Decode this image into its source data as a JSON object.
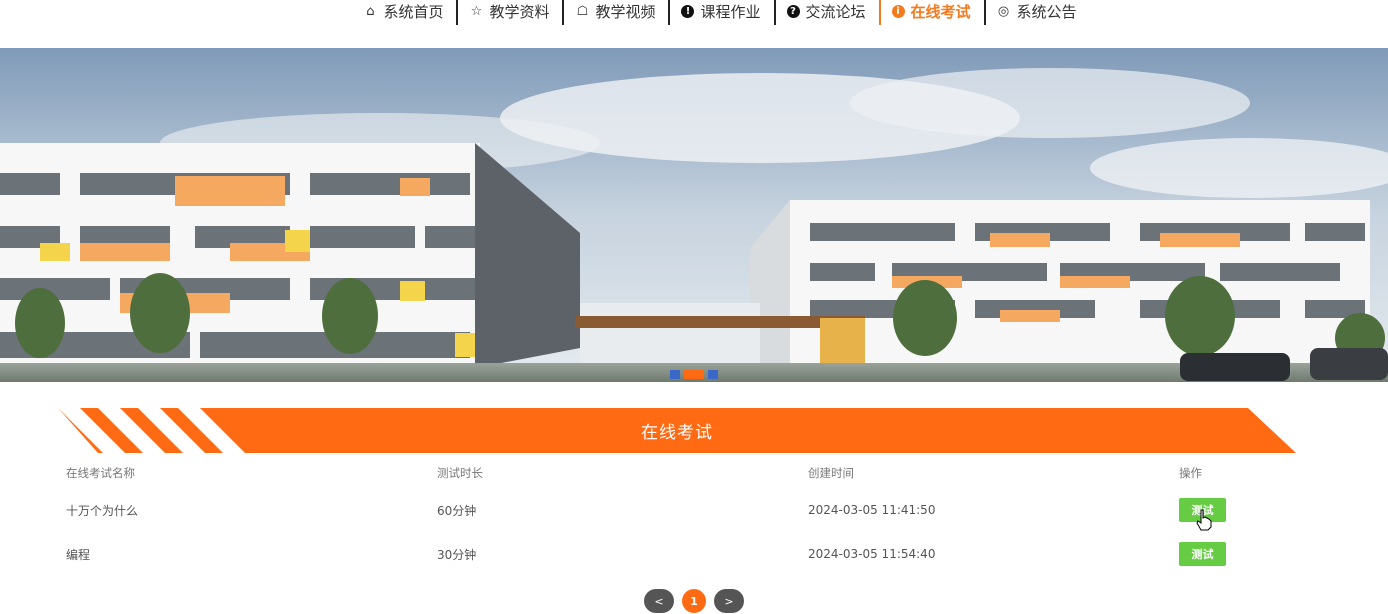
{
  "nav": {
    "items": [
      {
        "label": "系统首页",
        "icon": "home-icon",
        "glyph": "⌂",
        "active": false
      },
      {
        "label": "教学资料",
        "icon": "star-icon",
        "glyph": "☆",
        "active": false
      },
      {
        "label": "教学视频",
        "icon": "bag-icon",
        "glyph": "☖",
        "active": false
      },
      {
        "label": "课程作业",
        "icon": "exclamation-icon",
        "glyph": "!",
        "active": false
      },
      {
        "label": "交流论坛",
        "icon": "question-icon",
        "glyph": "?",
        "active": false
      },
      {
        "label": "在线考试",
        "icon": "info-icon",
        "glyph": "i",
        "active": true
      },
      {
        "label": "系统公告",
        "icon": "support-icon",
        "glyph": "◎",
        "active": false
      }
    ]
  },
  "banner": {
    "slides": 3,
    "active_slide": 1
  },
  "exam": {
    "title": "在线考试",
    "columns": [
      "在线考试名称",
      "测试时长",
      "创建时间",
      "操作"
    ],
    "rows": [
      {
        "name": "十万个为什么",
        "duration": "60分钟",
        "created": "2024-03-05 11:41:50",
        "action": "测试"
      },
      {
        "name": "编程",
        "duration": "30分钟",
        "created": "2024-03-05 11:54:40",
        "action": "测试"
      }
    ]
  },
  "pager": {
    "prev": "<",
    "current": "1",
    "next": ">"
  },
  "colors": {
    "accent": "#ff6a13",
    "nav_active": "#f47a1f",
    "test_button": "#66cc44",
    "dot": "#3a67c8"
  }
}
